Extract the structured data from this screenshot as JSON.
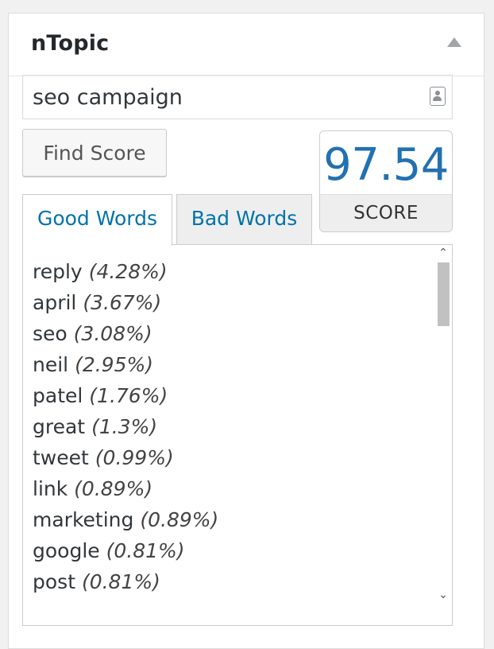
{
  "widget": {
    "title": "nTopic",
    "collapse_icon": "triangle-up-icon"
  },
  "search": {
    "value": "seo campaign",
    "icon": "contact-card-icon"
  },
  "find_button": {
    "label": "Find Score"
  },
  "score": {
    "value": "97.54",
    "label": "SCORE",
    "color": "#2271b1"
  },
  "tabs": [
    {
      "label": "Good Words",
      "active": true
    },
    {
      "label": "Bad Words",
      "active": false
    }
  ],
  "good_words": [
    {
      "word": "reply",
      "pct": "(4.28%)"
    },
    {
      "word": "april",
      "pct": "(3.67%)"
    },
    {
      "word": "seo",
      "pct": "(3.08%)"
    },
    {
      "word": "neil",
      "pct": "(2.95%)"
    },
    {
      "word": "patel",
      "pct": "(1.76%)"
    },
    {
      "word": "great",
      "pct": "(1.3%)"
    },
    {
      "word": "tweet",
      "pct": "(0.99%)"
    },
    {
      "word": "link",
      "pct": "(0.89%)"
    },
    {
      "word": "marketing",
      "pct": "(0.89%)"
    },
    {
      "word": "google",
      "pct": "(0.81%)"
    },
    {
      "word": "post",
      "pct": "(0.81%)"
    }
  ],
  "colors": {
    "accent": "#0073aa",
    "score": "#2271b1"
  }
}
